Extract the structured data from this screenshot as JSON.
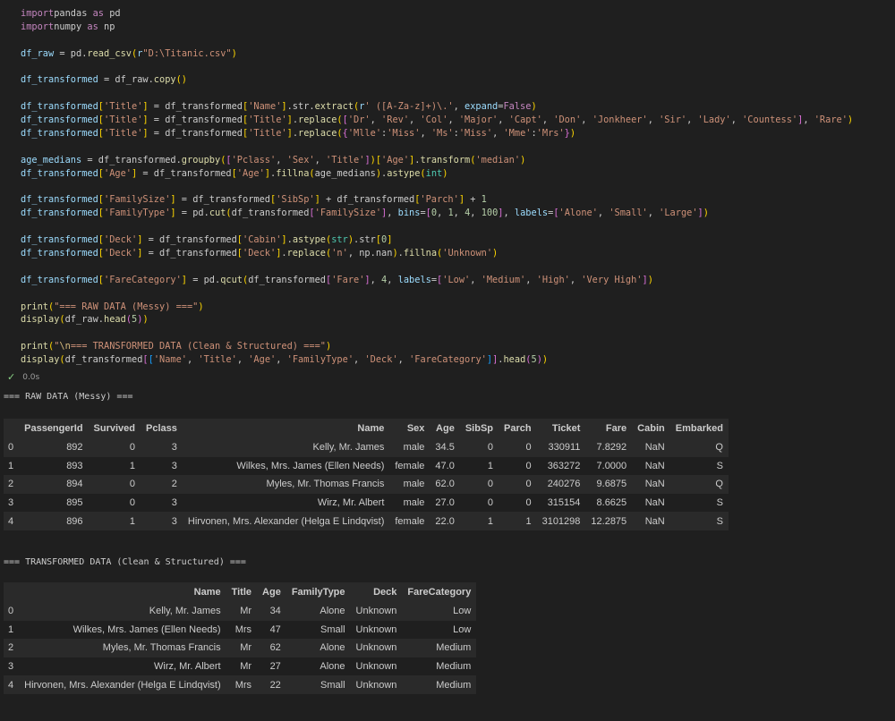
{
  "code_lines": [
    [
      [
        "kw",
        "import"
      ],
      [
        "",
        "pandas "
      ],
      [
        "kw",
        "as"
      ],
      [
        "",
        " pd"
      ]
    ],
    [
      [
        "kw",
        "import"
      ],
      [
        "",
        "numpy "
      ],
      [
        "kw",
        "as"
      ],
      [
        "",
        " np"
      ]
    ],
    [],
    [
      [
        "var",
        "df_raw"
      ],
      [
        "",
        " = pd."
      ],
      [
        "fn",
        "read_csv"
      ],
      [
        "b1",
        "("
      ],
      [
        "var",
        "r"
      ],
      [
        "str",
        "\"D:\\Titanic.csv\""
      ],
      [
        "b1",
        ")"
      ]
    ],
    [],
    [
      [
        "var",
        "df_transformed"
      ],
      [
        "",
        " = df_raw."
      ],
      [
        "fn",
        "copy"
      ],
      [
        "b1",
        "()"
      ]
    ],
    [],
    [
      [
        "var",
        "df_transformed"
      ],
      [
        "b1",
        "["
      ],
      [
        "str",
        "'Title'"
      ],
      [
        "b1",
        "]"
      ],
      [
        "",
        " = df_transformed"
      ],
      [
        "b1",
        "["
      ],
      [
        "str",
        "'Name'"
      ],
      [
        "b1",
        "]"
      ],
      [
        "",
        ".str."
      ],
      [
        "fn",
        "extract"
      ],
      [
        "b1",
        "("
      ],
      [
        "var",
        "r"
      ],
      [
        "str",
        "' ([A-Za-z]+)\\.'"
      ],
      [
        "",
        ", "
      ],
      [
        "var",
        "expand"
      ],
      [
        "",
        "="
      ],
      [
        "kw",
        "False"
      ],
      [
        "b1",
        ")"
      ]
    ],
    [
      [
        "var",
        "df_transformed"
      ],
      [
        "b1",
        "["
      ],
      [
        "str",
        "'Title'"
      ],
      [
        "b1",
        "]"
      ],
      [
        "",
        " = df_transformed"
      ],
      [
        "b1",
        "["
      ],
      [
        "str",
        "'Title'"
      ],
      [
        "b1",
        "]"
      ],
      [
        "",
        "."
      ],
      [
        "fn",
        "replace"
      ],
      [
        "b1",
        "("
      ],
      [
        "b2",
        "["
      ],
      [
        "str",
        "'Dr'"
      ],
      [
        "",
        ", "
      ],
      [
        "str",
        "'Rev'"
      ],
      [
        "",
        ", "
      ],
      [
        "str",
        "'Col'"
      ],
      [
        "",
        ", "
      ],
      [
        "str",
        "'Major'"
      ],
      [
        "",
        ", "
      ],
      [
        "str",
        "'Capt'"
      ],
      [
        "",
        ", "
      ],
      [
        "str",
        "'Don'"
      ],
      [
        "",
        ", "
      ],
      [
        "str",
        "'Jonkheer'"
      ],
      [
        "",
        ", "
      ],
      [
        "str",
        "'Sir'"
      ],
      [
        "",
        ", "
      ],
      [
        "str",
        "'Lady'"
      ],
      [
        "",
        ", "
      ],
      [
        "str",
        "'Countess'"
      ],
      [
        "b2",
        "]"
      ],
      [
        "",
        ", "
      ],
      [
        "str",
        "'Rare'"
      ],
      [
        "b1",
        ")"
      ]
    ],
    [
      [
        "var",
        "df_transformed"
      ],
      [
        "b1",
        "["
      ],
      [
        "str",
        "'Title'"
      ],
      [
        "b1",
        "]"
      ],
      [
        "",
        " = df_transformed"
      ],
      [
        "b1",
        "["
      ],
      [
        "str",
        "'Title'"
      ],
      [
        "b1",
        "]"
      ],
      [
        "",
        "."
      ],
      [
        "fn",
        "replace"
      ],
      [
        "b1",
        "("
      ],
      [
        "b2",
        "{"
      ],
      [
        "str",
        "'Mlle'"
      ],
      [
        "",
        ":"
      ],
      [
        "str",
        "'Miss'"
      ],
      [
        "",
        ", "
      ],
      [
        "str",
        "'Ms'"
      ],
      [
        "",
        ":"
      ],
      [
        "str",
        "'Miss'"
      ],
      [
        "",
        ", "
      ],
      [
        "str",
        "'Mme'"
      ],
      [
        "",
        ":"
      ],
      [
        "str",
        "'Mrs'"
      ],
      [
        "b2",
        "}"
      ],
      [
        "b1",
        ")"
      ]
    ],
    [],
    [
      [
        "var",
        "age_medians"
      ],
      [
        "",
        " = df_transformed."
      ],
      [
        "fn",
        "groupby"
      ],
      [
        "b1",
        "("
      ],
      [
        "b2",
        "["
      ],
      [
        "str",
        "'Pclass'"
      ],
      [
        "",
        ", "
      ],
      [
        "str",
        "'Sex'"
      ],
      [
        "",
        ", "
      ],
      [
        "str",
        "'Title'"
      ],
      [
        "b2",
        "]"
      ],
      [
        "b1",
        ")"
      ],
      [
        "b1",
        "["
      ],
      [
        "str",
        "'Age'"
      ],
      [
        "b1",
        "]"
      ],
      [
        "",
        "."
      ],
      [
        "fn",
        "transform"
      ],
      [
        "b1",
        "("
      ],
      [
        "str",
        "'median'"
      ],
      [
        "b1",
        ")"
      ]
    ],
    [
      [
        "var",
        "df_transformed"
      ],
      [
        "b1",
        "["
      ],
      [
        "str",
        "'Age'"
      ],
      [
        "b1",
        "]"
      ],
      [
        "",
        " = df_transformed"
      ],
      [
        "b1",
        "["
      ],
      [
        "str",
        "'Age'"
      ],
      [
        "b1",
        "]"
      ],
      [
        "",
        "."
      ],
      [
        "fn",
        "fillna"
      ],
      [
        "b1",
        "("
      ],
      [
        "",
        "age_medians"
      ],
      [
        "b1",
        ")"
      ],
      [
        "",
        "."
      ],
      [
        "fn",
        "astype"
      ],
      [
        "b1",
        "("
      ],
      [
        "cls",
        "int"
      ],
      [
        "b1",
        ")"
      ]
    ],
    [],
    [
      [
        "var",
        "df_transformed"
      ],
      [
        "b1",
        "["
      ],
      [
        "str",
        "'FamilySize'"
      ],
      [
        "b1",
        "]"
      ],
      [
        "",
        " = df_transformed"
      ],
      [
        "b1",
        "["
      ],
      [
        "str",
        "'SibSp'"
      ],
      [
        "b1",
        "]"
      ],
      [
        "",
        " + df_transformed"
      ],
      [
        "b1",
        "["
      ],
      [
        "str",
        "'Parch'"
      ],
      [
        "b1",
        "]"
      ],
      [
        "",
        " + "
      ],
      [
        "num",
        "1"
      ]
    ],
    [
      [
        "var",
        "df_transformed"
      ],
      [
        "b1",
        "["
      ],
      [
        "str",
        "'FamilyType'"
      ],
      [
        "b1",
        "]"
      ],
      [
        "",
        " = pd."
      ],
      [
        "fn",
        "cut"
      ],
      [
        "b1",
        "("
      ],
      [
        "",
        "df_transformed"
      ],
      [
        "b2",
        "["
      ],
      [
        "str",
        "'FamilySize'"
      ],
      [
        "b2",
        "]"
      ],
      [
        "",
        ", "
      ],
      [
        "var",
        "bins"
      ],
      [
        "",
        "="
      ],
      [
        "b2",
        "["
      ],
      [
        "num",
        "0"
      ],
      [
        "",
        ", "
      ],
      [
        "num",
        "1"
      ],
      [
        "",
        ", "
      ],
      [
        "num",
        "4"
      ],
      [
        "",
        ", "
      ],
      [
        "num",
        "100"
      ],
      [
        "b2",
        "]"
      ],
      [
        "",
        ", "
      ],
      [
        "var",
        "labels"
      ],
      [
        "",
        "="
      ],
      [
        "b2",
        "["
      ],
      [
        "str",
        "'Alone'"
      ],
      [
        "",
        ", "
      ],
      [
        "str",
        "'Small'"
      ],
      [
        "",
        ", "
      ],
      [
        "str",
        "'Large'"
      ],
      [
        "b2",
        "]"
      ],
      [
        "b1",
        ")"
      ]
    ],
    [],
    [
      [
        "var",
        "df_transformed"
      ],
      [
        "b1",
        "["
      ],
      [
        "str",
        "'Deck'"
      ],
      [
        "b1",
        "]"
      ],
      [
        "",
        " = df_transformed"
      ],
      [
        "b1",
        "["
      ],
      [
        "str",
        "'Cabin'"
      ],
      [
        "b1",
        "]"
      ],
      [
        "",
        "."
      ],
      [
        "fn",
        "astype"
      ],
      [
        "b1",
        "("
      ],
      [
        "cls",
        "str"
      ],
      [
        "b1",
        ")"
      ],
      [
        "",
        ".str"
      ],
      [
        "b1",
        "["
      ],
      [
        "num",
        "0"
      ],
      [
        "b1",
        "]"
      ]
    ],
    [
      [
        "var",
        "df_transformed"
      ],
      [
        "b1",
        "["
      ],
      [
        "str",
        "'Deck'"
      ],
      [
        "b1",
        "]"
      ],
      [
        "",
        " = df_transformed"
      ],
      [
        "b1",
        "["
      ],
      [
        "str",
        "'Deck'"
      ],
      [
        "b1",
        "]"
      ],
      [
        "",
        "."
      ],
      [
        "fn",
        "replace"
      ],
      [
        "b1",
        "("
      ],
      [
        "str",
        "'n'"
      ],
      [
        "",
        ", np.nan"
      ],
      [
        "b1",
        ")"
      ],
      [
        "",
        "."
      ],
      [
        "fn",
        "fillna"
      ],
      [
        "b1",
        "("
      ],
      [
        "str",
        "'Unknown'"
      ],
      [
        "b1",
        ")"
      ]
    ],
    [],
    [
      [
        "var",
        "df_transformed"
      ],
      [
        "b1",
        "["
      ],
      [
        "str",
        "'FareCategory'"
      ],
      [
        "b1",
        "]"
      ],
      [
        "",
        " = pd."
      ],
      [
        "fn",
        "qcut"
      ],
      [
        "b1",
        "("
      ],
      [
        "",
        "df_transformed"
      ],
      [
        "b2",
        "["
      ],
      [
        "str",
        "'Fare'"
      ],
      [
        "b2",
        "]"
      ],
      [
        "",
        ", "
      ],
      [
        "num",
        "4"
      ],
      [
        "",
        ", "
      ],
      [
        "var",
        "labels"
      ],
      [
        "",
        "="
      ],
      [
        "b2",
        "["
      ],
      [
        "str",
        "'Low'"
      ],
      [
        "",
        ", "
      ],
      [
        "str",
        "'Medium'"
      ],
      [
        "",
        ", "
      ],
      [
        "str",
        "'High'"
      ],
      [
        "",
        ", "
      ],
      [
        "str",
        "'Very High'"
      ],
      [
        "b2",
        "]"
      ],
      [
        "b1",
        ")"
      ]
    ],
    [],
    [
      [
        "fn",
        "print"
      ],
      [
        "b1",
        "("
      ],
      [
        "str",
        "\"=== RAW DATA (Messy) ===\""
      ],
      [
        "b1",
        ")"
      ]
    ],
    [
      [
        "fn",
        "display"
      ],
      [
        "b1",
        "("
      ],
      [
        "",
        "df_raw."
      ],
      [
        "fn",
        "head"
      ],
      [
        "b2",
        "("
      ],
      [
        "num",
        "5"
      ],
      [
        "b2",
        ")"
      ],
      [
        "b1",
        ")"
      ]
    ],
    [],
    [
      [
        "fn",
        "print"
      ],
      [
        "b1",
        "("
      ],
      [
        "str",
        "\""
      ],
      [
        "esc",
        "\\n"
      ],
      [
        "str",
        "=== TRANSFORMED DATA (Clean & Structured) ===\""
      ],
      [
        "b1",
        ")"
      ]
    ],
    [
      [
        "fn",
        "display"
      ],
      [
        "b1",
        "("
      ],
      [
        "",
        "df_transformed"
      ],
      [
        "b2",
        "["
      ],
      [
        "b3",
        "["
      ],
      [
        "str",
        "'Name'"
      ],
      [
        "",
        ", "
      ],
      [
        "str",
        "'Title'"
      ],
      [
        "",
        ", "
      ],
      [
        "str",
        "'Age'"
      ],
      [
        "",
        ", "
      ],
      [
        "str",
        "'FamilyType'"
      ],
      [
        "",
        ", "
      ],
      [
        "str",
        "'Deck'"
      ],
      [
        "",
        ", "
      ],
      [
        "str",
        "'FareCategory'"
      ],
      [
        "b3",
        "]"
      ],
      [
        "b2",
        "]"
      ],
      [
        "",
        "."
      ],
      [
        "fn",
        "head"
      ],
      [
        "b2",
        "("
      ],
      [
        "num",
        "5"
      ],
      [
        "b2",
        ")"
      ],
      [
        "b1",
        ")"
      ]
    ]
  ],
  "status": {
    "check_icon": "check-icon",
    "time": "0.0s"
  },
  "raw_title": "=== RAW DATA (Messy) ===",
  "raw_table": {
    "columns": [
      "",
      "PassengerId",
      "Survived",
      "Pclass",
      "Name",
      "Sex",
      "Age",
      "SibSp",
      "Parch",
      "Ticket",
      "Fare",
      "Cabin",
      "Embarked"
    ],
    "rows": [
      [
        "0",
        "892",
        "0",
        "3",
        "Kelly, Mr. James",
        "male",
        "34.5",
        "0",
        "0",
        "330911",
        "7.8292",
        "NaN",
        "Q"
      ],
      [
        "1",
        "893",
        "1",
        "3",
        "Wilkes, Mrs. James (Ellen Needs)",
        "female",
        "47.0",
        "1",
        "0",
        "363272",
        "7.0000",
        "NaN",
        "S"
      ],
      [
        "2",
        "894",
        "0",
        "2",
        "Myles, Mr. Thomas Francis",
        "male",
        "62.0",
        "0",
        "0",
        "240276",
        "9.6875",
        "NaN",
        "Q"
      ],
      [
        "3",
        "895",
        "0",
        "3",
        "Wirz, Mr. Albert",
        "male",
        "27.0",
        "0",
        "0",
        "315154",
        "8.6625",
        "NaN",
        "S"
      ],
      [
        "4",
        "896",
        "1",
        "3",
        "Hirvonen, Mrs. Alexander (Helga E Lindqvist)",
        "female",
        "22.0",
        "1",
        "1",
        "3101298",
        "12.2875",
        "NaN",
        "S"
      ]
    ]
  },
  "transformed_title": "=== TRANSFORMED DATA (Clean & Structured) ===",
  "transformed_table": {
    "columns": [
      "",
      "Name",
      "Title",
      "Age",
      "FamilyType",
      "Deck",
      "FareCategory"
    ],
    "rows": [
      [
        "0",
        "Kelly, Mr. James",
        "Mr",
        "34",
        "Alone",
        "Unknown",
        "Low"
      ],
      [
        "1",
        "Wilkes, Mrs. James (Ellen Needs)",
        "Mrs",
        "47",
        "Small",
        "Unknown",
        "Low"
      ],
      [
        "2",
        "Myles, Mr. Thomas Francis",
        "Mr",
        "62",
        "Alone",
        "Unknown",
        "Medium"
      ],
      [
        "3",
        "Wirz, Mr. Albert",
        "Mr",
        "27",
        "Alone",
        "Unknown",
        "Medium"
      ],
      [
        "4",
        "Hirvonen, Mrs. Alexander (Helga E Lindqvist)",
        "Mrs",
        "22",
        "Small",
        "Unknown",
        "Medium"
      ]
    ]
  }
}
